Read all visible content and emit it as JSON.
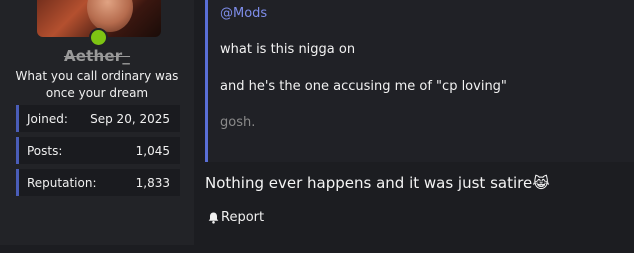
{
  "user": {
    "name": "Aether_",
    "title": "What you call ordinary was once your dream",
    "online_color": "#7ec413",
    "stats": [
      {
        "label": "Joined:",
        "value": "Sep 20, 2025"
      },
      {
        "label": "Posts:",
        "value": "1,045"
      },
      {
        "label": "Reputation:",
        "value": "1,833"
      }
    ]
  },
  "quote": {
    "mention": "@Mods",
    "lines": [
      "what is this nigga on",
      "and he's the one accusing me of \"cp loving\"",
      "gosh."
    ]
  },
  "post": {
    "text": "Nothing ever happens and it was just satire",
    "emoji": "😹"
  },
  "actions": {
    "report_label": "Report",
    "report_icon": "bell-icon"
  }
}
